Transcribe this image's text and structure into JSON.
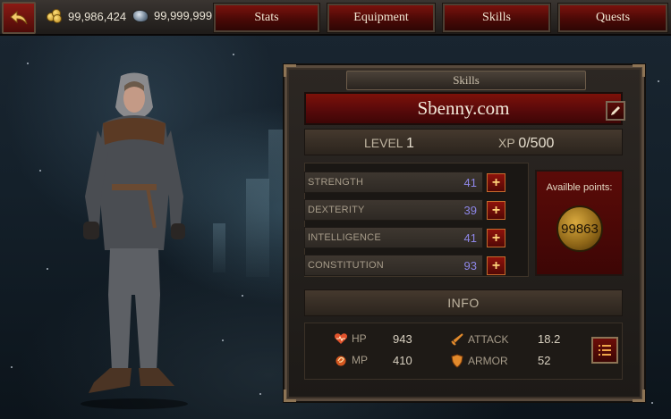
{
  "topbar": {
    "gold": "99,986,424",
    "gems": "99,999,999",
    "tabs": [
      {
        "label": "Stats"
      },
      {
        "label": "Equipment"
      },
      {
        "label": "Skills"
      },
      {
        "label": "Quests"
      }
    ]
  },
  "panel": {
    "header": "Skills",
    "character_name": "Sbenny.com",
    "level_label": "LEVEL",
    "level_value": "1",
    "xp_label": "XP",
    "xp_value": "0/500",
    "stats": [
      {
        "label": "STRENGTH",
        "value": "41"
      },
      {
        "label": "DEXTERITY",
        "value": "39"
      },
      {
        "label": "INTELLIGENCE",
        "value": "41"
      },
      {
        "label": "CONSTITUTION",
        "value": "93"
      }
    ],
    "plus_symbol": "+",
    "points_label": "Availble points:",
    "points_value": "99863",
    "info_label": "INFO",
    "info": {
      "hp_label": "HP",
      "hp_value": "943",
      "mp_label": "MP",
      "mp_value": "410",
      "attack_label": "ATTACK",
      "attack_value": "18.2",
      "armor_label": "ARMOR",
      "armor_value": "52"
    }
  },
  "icons": {
    "back": "back-arrow-icon",
    "gold": "gold-coins-icon",
    "gem": "gem-icon",
    "edit": "pencil-icon",
    "hp": "heart-icon",
    "mp": "mana-icon",
    "attack": "sword-icon",
    "armor": "shield-icon",
    "list": "list-icon"
  },
  "colors": {
    "accent_red": "#7d1109",
    "stat_value": "#8d86e6",
    "gold": "#d9a93e"
  }
}
